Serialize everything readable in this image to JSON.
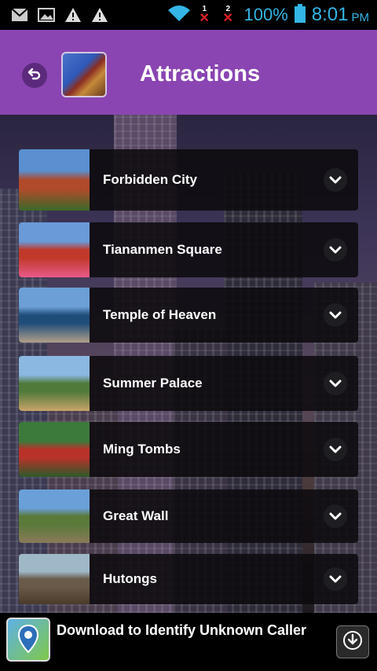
{
  "status_bar": {
    "battery_percent": "100%",
    "time": "8:01",
    "ampm": "PM",
    "sim1": "1",
    "sim2": "2",
    "icons": [
      "gmail-icon",
      "image-icon",
      "warning-icon",
      "warning-icon",
      "wifi-icon",
      "no-signal-icon",
      "no-signal-icon",
      "battery-icon"
    ],
    "accent_color": "#33b5e5"
  },
  "header": {
    "title": "Attractions",
    "color": "#8a45b2"
  },
  "attractions": [
    {
      "label": "Forbidden City",
      "thumb": [
        "#5a8fd0",
        "#b04a2a",
        "#3a6a2a"
      ]
    },
    {
      "label": "Tiananmen Square",
      "thumb": [
        "#6a9ad8",
        "#c0392b",
        "#e85a8a"
      ]
    },
    {
      "label": "Temple of Heaven",
      "thumb": [
        "#6b9fd6",
        "#1f4d7a",
        "#b0a08a"
      ]
    },
    {
      "label": "Summer Palace",
      "thumb": [
        "#8ab8e0",
        "#4f7a3a",
        "#c9a46a"
      ]
    },
    {
      "label": "Ming Tombs",
      "thumb": [
        "#3c7a3c",
        "#b8322a",
        "#2d5a2a"
      ]
    },
    {
      "label": "Great Wall",
      "thumb": [
        "#6aa0d8",
        "#5a7a3a",
        "#8a7a5a"
      ]
    },
    {
      "label": "Hutongs",
      "thumb": [
        "#9fb8c8",
        "#6a5a4a",
        "#4a3a2a"
      ]
    }
  ],
  "ad": {
    "text": "Download to Identify Unknown Caller"
  }
}
